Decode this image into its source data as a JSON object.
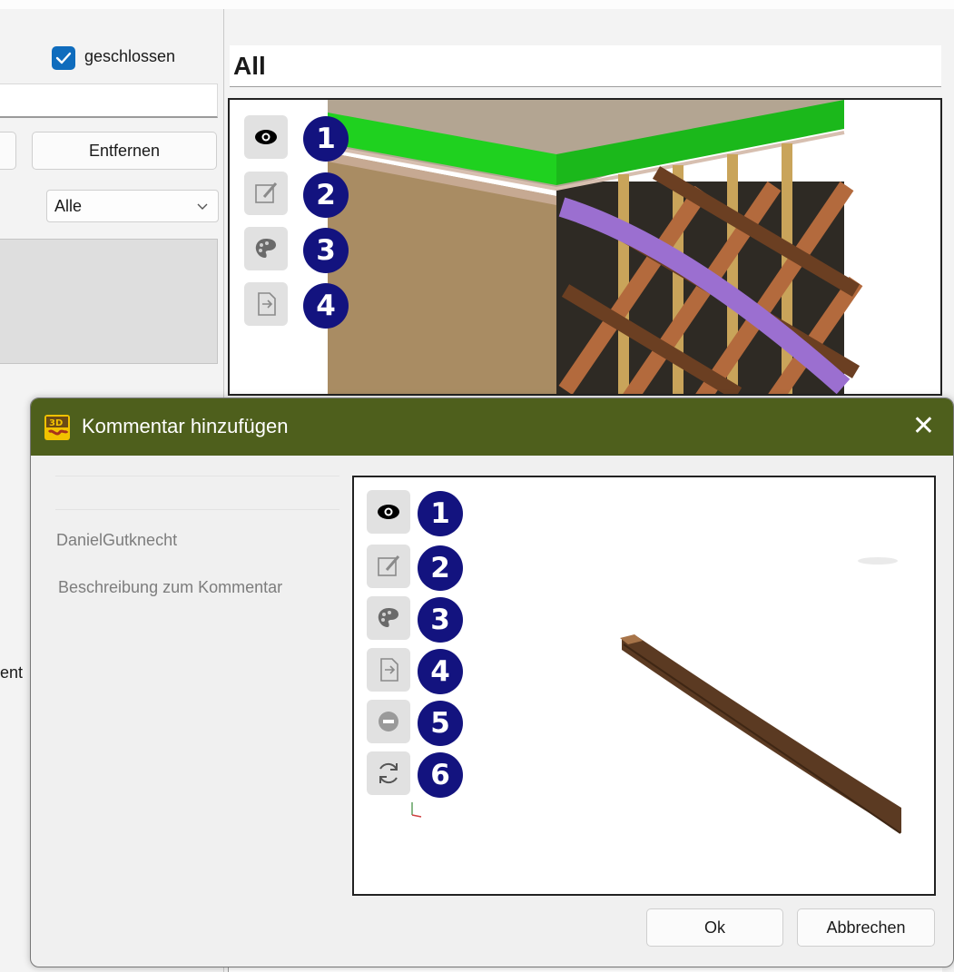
{
  "background": {
    "closed_checkbox": {
      "label": "geschlossen",
      "checked": true
    },
    "remove_button": "Entfernen",
    "filter": {
      "selected": "Alle"
    },
    "cut_text": "ent",
    "view_title": "All",
    "toolbar_numbers": [
      "1",
      "2",
      "3",
      "4"
    ]
  },
  "dialog": {
    "title": "Kommentar hinzufügen",
    "close_symbol": "✕",
    "author": "DanielGutknecht",
    "description_placeholder": "Beschreibung zum Kommentar",
    "toolbar_numbers": [
      "1",
      "2",
      "3",
      "4",
      "5",
      "6"
    ],
    "ok_label": "Ok",
    "cancel_label": "Abbrechen"
  },
  "icons": [
    "eye-icon",
    "edit-icon",
    "palette-icon",
    "export-icon",
    "remove-icon",
    "refresh-icon"
  ],
  "colors": {
    "titlebar": "#4e5f1c",
    "number_badge": "#13137f",
    "checkbox": "#0f6cbd",
    "beam": "#5b3a22",
    "highlight_green": "#1fd11f",
    "highlight_purple": "#9b6fd0"
  }
}
